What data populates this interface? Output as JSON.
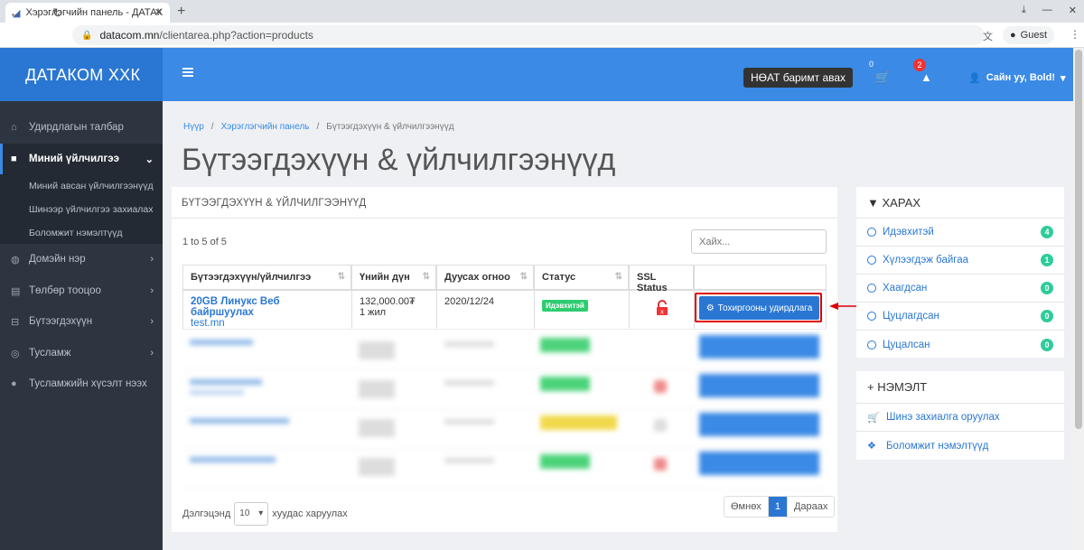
{
  "browser": {
    "tab_title": "Хэрэглэгчийн панель - ДАТАК",
    "url_host": "datacom.mn",
    "url_path": "/clientarea.php?action=products",
    "profile": "Guest"
  },
  "header": {
    "brand": "ДАТАКОМ ХХК",
    "vat_button": "НӨАТ баримт авах",
    "cart_count": "0",
    "alert_count": "2",
    "user_greeting": "Сайн уу, Bold!"
  },
  "sidebar": {
    "items": [
      {
        "label": "Удирдлагын талбар"
      },
      {
        "label": "Миний үйлчилгээ"
      },
      {
        "label": "Домэйн нэр"
      },
      {
        "label": "Төлбөр тооцоо"
      },
      {
        "label": "Бүтээгдэхүүн"
      },
      {
        "label": "Тусламж"
      },
      {
        "label": "Тусламжийн хүсэлт нээх"
      }
    ],
    "subitems": [
      {
        "label": "Миний авсан үйлчилгээнүүд"
      },
      {
        "label": "Шинээр үйлчилгээ захиалах"
      },
      {
        "label": "Боломжит нэмэлтүүд"
      }
    ]
  },
  "breadcrumb": [
    "Нүүр",
    "Хэрэглэгчийн панель",
    "Бүтээгдэхүүн & үйлчилгээнүүд"
  ],
  "page_title": "Бүтээгдэхүүн & үйлчилгээнүүд",
  "panel": {
    "title": "БҮТЭЭГДЭХҮҮН & ҮЙЛЧИЛГЭЭНҮҮД",
    "count_text": "1 to 5 of 5",
    "search_placeholder": "Хайх...",
    "columns": [
      "Бүтээгдэхүүн/үйлчилгээ",
      "Үнийн дүн",
      "Дуусах огноо",
      "Статус",
      "SSL Status",
      ""
    ],
    "rows": [
      {
        "name": "20GB Линукс Веб байршуулах",
        "domain": "test.mn",
        "price": "132,000.00₮",
        "cycle": "1 жил",
        "due": "2020/12/24",
        "status": "Идэвхитэй",
        "action": "Тохиргооны удирдлага"
      }
    ],
    "page_size_label_before": "Дэлгэцэнд",
    "page_size": "10",
    "page_size_label_after": "хуудас харуулах",
    "pager_prev": "Өмнөх",
    "pager_current": "1",
    "pager_next": "Дараах"
  },
  "filter_panel": {
    "title": "ХАРАХ",
    "items": [
      {
        "label": "Идэвхитэй",
        "count": "4"
      },
      {
        "label": "Хүлээгдэж байгаа",
        "count": "1"
      },
      {
        "label": "Хаагдсан",
        "count": "0"
      },
      {
        "label": "Цуцлагдсан",
        "count": "0"
      },
      {
        "label": "Цуцалсан",
        "count": "0"
      }
    ]
  },
  "extra_panel": {
    "title": "НЭМЭЛТ",
    "items": [
      {
        "label": "Шинэ захиалга оруулах"
      },
      {
        "label": "Боломжит нэмэлтүүд"
      }
    ]
  },
  "colors": {
    "primary": "#3a8ae6",
    "brand": "#2a77d3",
    "sidebar": "#2d3540",
    "success": "#2ecc71",
    "highlight": "#dd0000"
  }
}
